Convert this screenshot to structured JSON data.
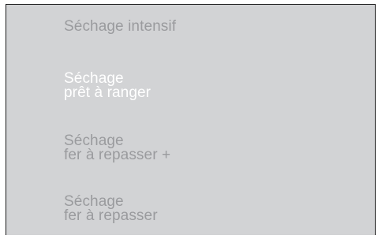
{
  "menu": {
    "items": [
      {
        "lines": [
          "Séchage intensif"
        ],
        "selected": false
      },
      {
        "lines": [
          "Séchage",
          "prêt à ranger"
        ],
        "selected": true
      },
      {
        "lines": [
          "Séchage",
          "fer à repasser +"
        ],
        "selected": false
      },
      {
        "lines": [
          "Séchage",
          "fer à repasser"
        ],
        "selected": false
      }
    ]
  },
  "colors": {
    "panel_background": "#d2d3d5",
    "selected_text": "#ffffff",
    "unselected_text": "#9a9b9e",
    "frame": "#1a1a1a"
  }
}
